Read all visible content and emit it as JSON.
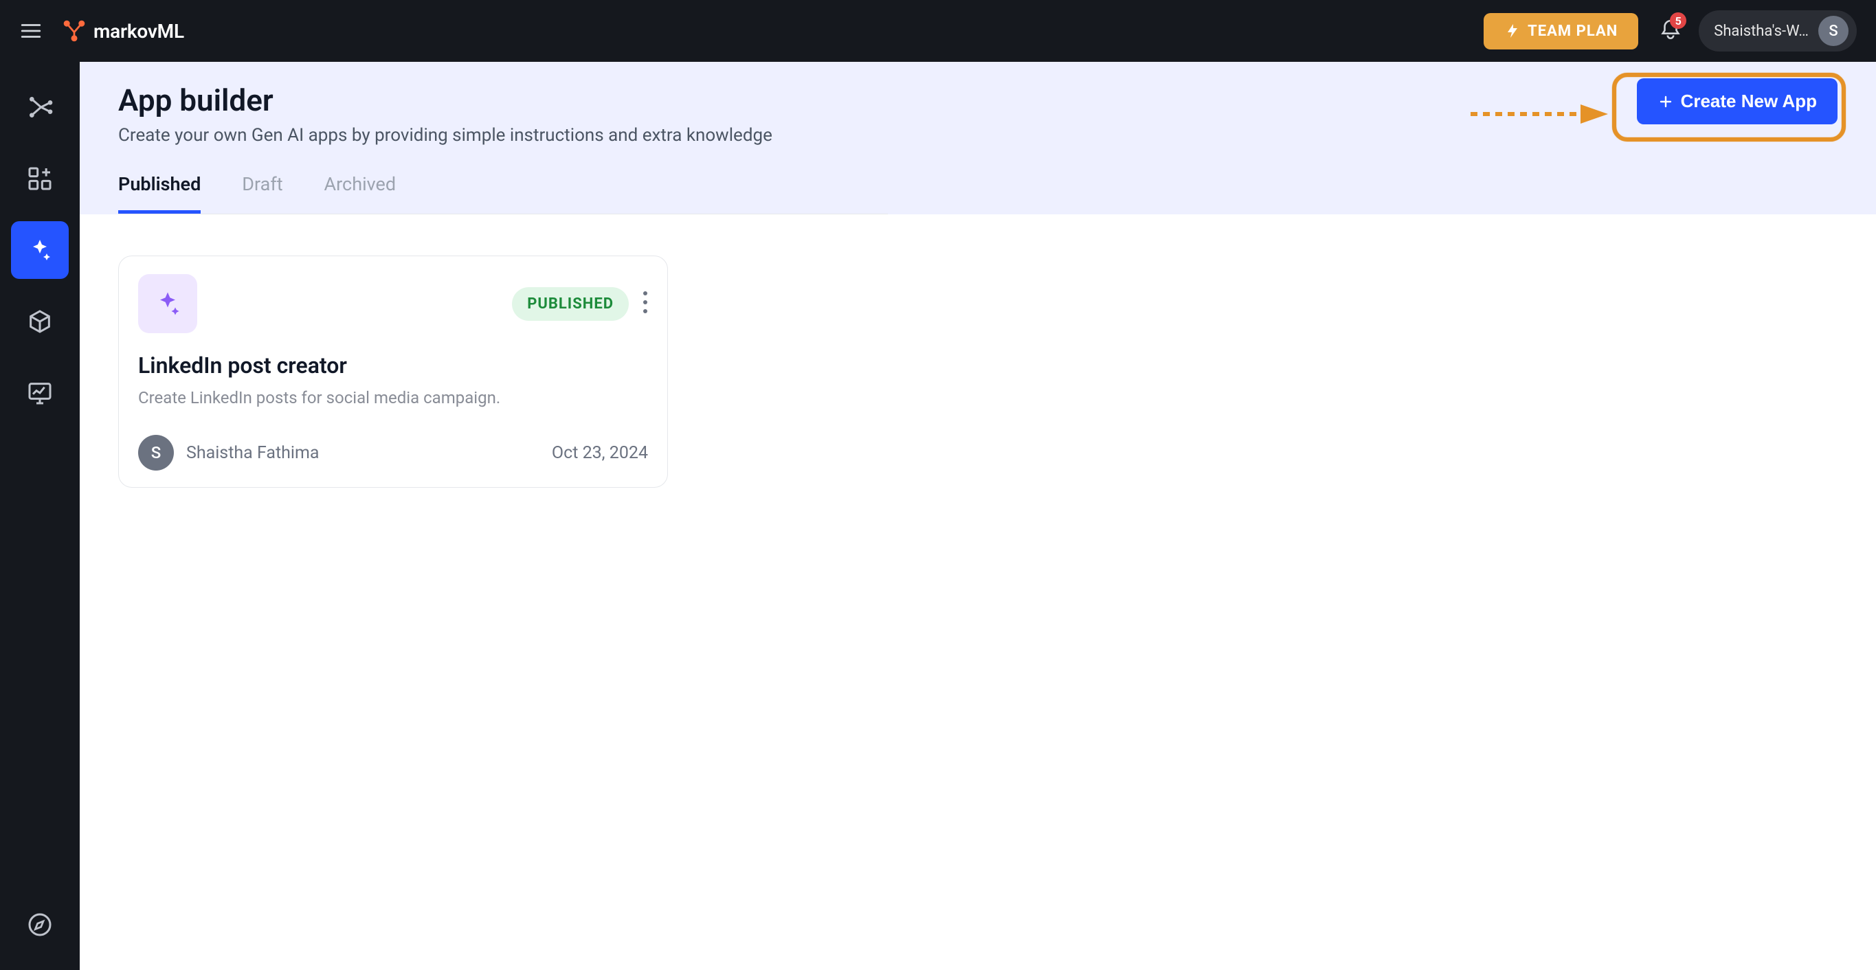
{
  "brand": {
    "name": "markovML"
  },
  "team_plan_label": "TEAM PLAN",
  "notifications_count": "5",
  "workspace_label": "Shaistha's-W…",
  "workspace_avatar_initial": "S",
  "page": {
    "title": "App builder",
    "subtitle": "Create your own Gen AI apps by providing simple instructions and extra knowledge",
    "create_button": "Create New App"
  },
  "tabs": [
    {
      "label": "Published",
      "active": true
    },
    {
      "label": "Draft",
      "active": false
    },
    {
      "label": "Archived",
      "active": false
    }
  ],
  "apps": [
    {
      "status": "PUBLISHED",
      "title": "LinkedIn post creator",
      "description": "Create LinkedIn posts for social media campaign.",
      "owner_initial": "S",
      "owner_name": "Shaistha Fathima",
      "date": "Oct 23, 2024"
    }
  ]
}
